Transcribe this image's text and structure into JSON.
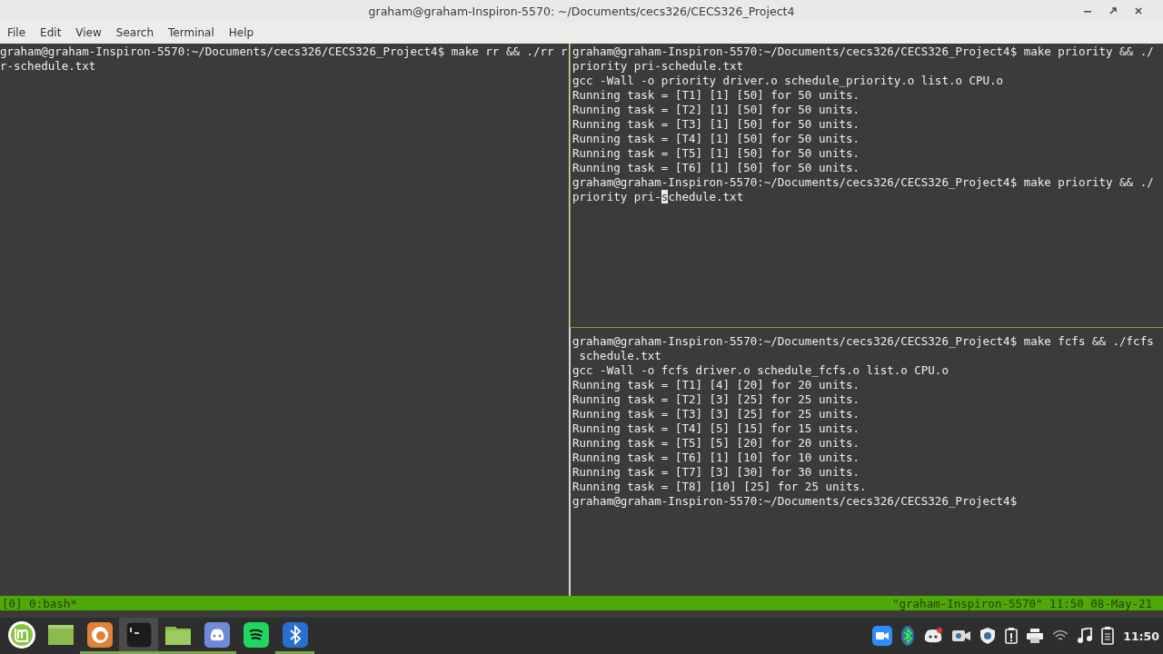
{
  "window": {
    "title": "graham@graham-Inspiron-5570: ~/Documents/cecs326/CECS326_Project4"
  },
  "menu": [
    "File",
    "Edit",
    "View",
    "Search",
    "Terminal",
    "Help"
  ],
  "panes": [
    {
      "active": false,
      "lines": [
        "graham@graham-Inspiron-5570:~/Documents/cecs326/CECS326_Project4$ make rr && ./rr r",
        "r-schedule.txt"
      ]
    },
    {
      "active": true,
      "lines": [
        "graham@graham-Inspiron-5570:~/Documents/cecs326/CECS326_Project4$ make priority && ./",
        "priority pri-schedule.txt",
        "gcc -Wall -o priority driver.o schedule_priority.o list.o CPU.o",
        "Running task = [T1] [1] [50] for 50 units.",
        "Running task = [T2] [1] [50] for 50 units.",
        "Running task = [T3] [1] [50] for 50 units.",
        "Running task = [T4] [1] [50] for 50 units.",
        "Running task = [T5] [1] [50] for 50 units.",
        "Running task = [T6] [1] [50] for 50 units.",
        "graham@graham-Inspiron-5570:~/Documents/cecs326/CECS326_Project4$ make priority && ./"
      ],
      "cursor_line": {
        "before": "priority pri-",
        "cursor": "s",
        "after": "chedule.txt"
      }
    },
    {
      "active": false,
      "lines": [
        "graham@graham-Inspiron-5570:~/Documents/cecs326/CECS326_Project4$ make fcfs && ./fcfs",
        " schedule.txt",
        "gcc -Wall -o fcfs driver.o schedule_fcfs.o list.o CPU.o",
        "Running task = [T1] [4] [20] for 20 units.",
        "Running task = [T2] [3] [25] for 25 units.",
        "Running task = [T3] [3] [25] for 25 units.",
        "Running task = [T4] [5] [15] for 15 units.",
        "Running task = [T5] [5] [20] for 20 units.",
        "Running task = [T6] [1] [10] for 10 units.",
        "Running task = [T7] [3] [30] for 30 units.",
        "Running task = [T8] [10] [25] for 25 units.",
        "graham@graham-Inspiron-5570:~/Documents/cecs326/CECS326_Project4$"
      ]
    }
  ],
  "status_bar": {
    "left": "[0] 0:bash*",
    "right": "\"graham-Inspiron-5570\" 11:50 08-May-21"
  },
  "taskbar": {
    "launchers": [
      {
        "kind": "menu",
        "running": false,
        "active": false
      },
      {
        "kind": "desktop",
        "running": false,
        "active": false
      },
      {
        "kind": "firefox",
        "running": true,
        "active": false
      },
      {
        "kind": "terminal",
        "running": true,
        "active": true
      },
      {
        "kind": "folder",
        "running": true,
        "active": false
      },
      {
        "kind": "discord",
        "running": true,
        "active": false
      },
      {
        "kind": "spotify",
        "running": false,
        "active": false
      },
      {
        "kind": "bluetooth",
        "running": true,
        "active": false
      }
    ],
    "tray": [
      {
        "kind": "zoom"
      },
      {
        "kind": "bluetooth"
      },
      {
        "kind": "discord"
      },
      {
        "kind": "camera"
      },
      {
        "kind": "shield"
      },
      {
        "kind": "clipboard"
      },
      {
        "kind": "printer"
      },
      {
        "kind": "wifi"
      },
      {
        "kind": "music"
      },
      {
        "kind": "battery"
      }
    ],
    "clock": "11:50"
  }
}
